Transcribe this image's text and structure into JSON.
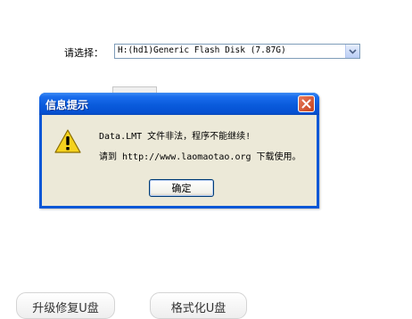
{
  "panel": {
    "select_label": "请选择：",
    "drive_value": "H:(hd1)Generic Flash Disk (7.87G)"
  },
  "bottom_buttons": {
    "repair": "升级修复U盘",
    "format": "格式化U盘"
  },
  "dialog": {
    "title": "信息提示",
    "message_line1": "Data.LMT 文件非法，程序不能继续!",
    "message_line2": "请到 http://www.laomaotao.org 下载使用。",
    "ok_label": "确定"
  },
  "colors": {
    "titlebar": "#0a5bdc",
    "dialog_body": "#ece9d8",
    "close_button": "#d4542f"
  },
  "icons": {
    "warning": "warning-icon",
    "close": "close-icon",
    "dropdown": "chevron-down-icon"
  }
}
